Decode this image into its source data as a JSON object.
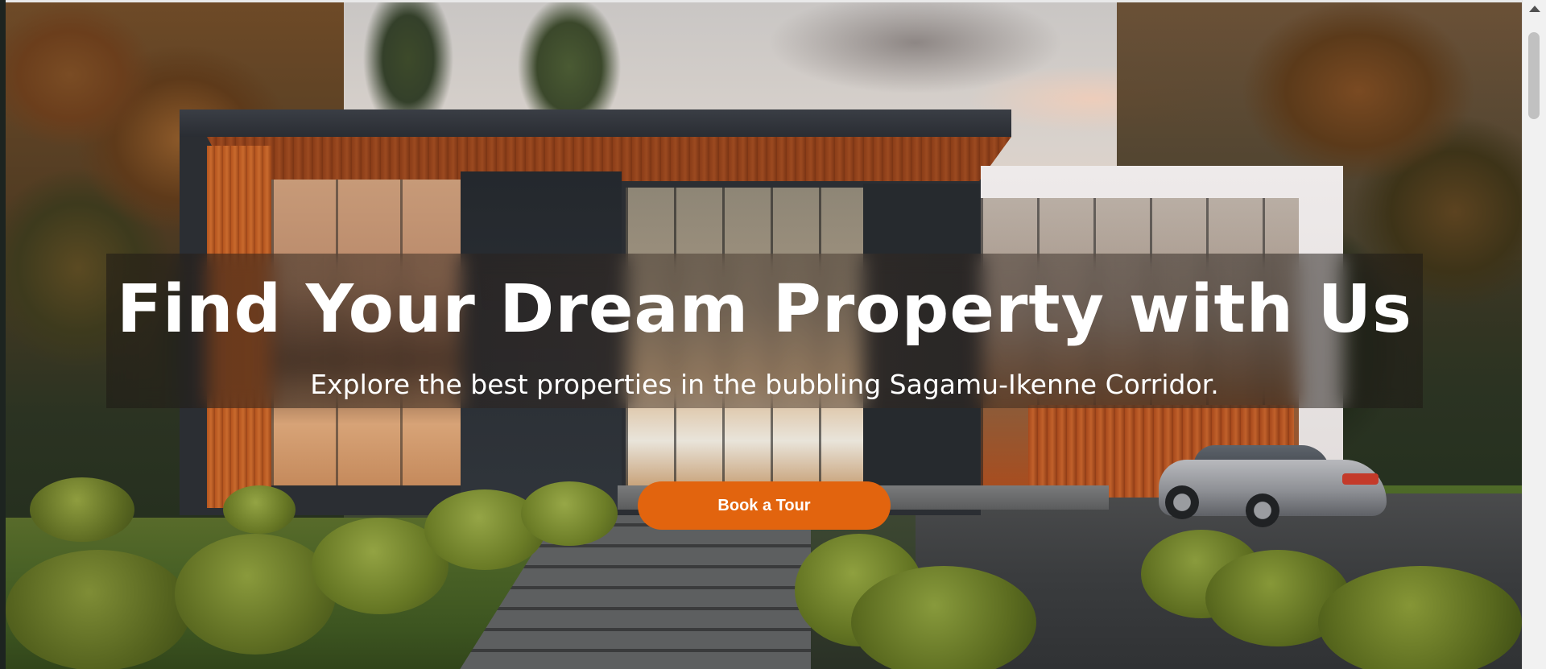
{
  "hero": {
    "title": "Find Your Dream Property with Us",
    "subtitle": "Explore the best properties in the bubbling Sagamu-Ikenne Corridor.",
    "cta_label": "Book a Tour",
    "background_image": "modern-house-photo"
  },
  "colors": {
    "cta_background": "#e2640e",
    "cta_text": "#ffffff",
    "title_text": "#ffffff"
  },
  "scrollbar": {
    "up_icon": "chevron-up-icon"
  }
}
